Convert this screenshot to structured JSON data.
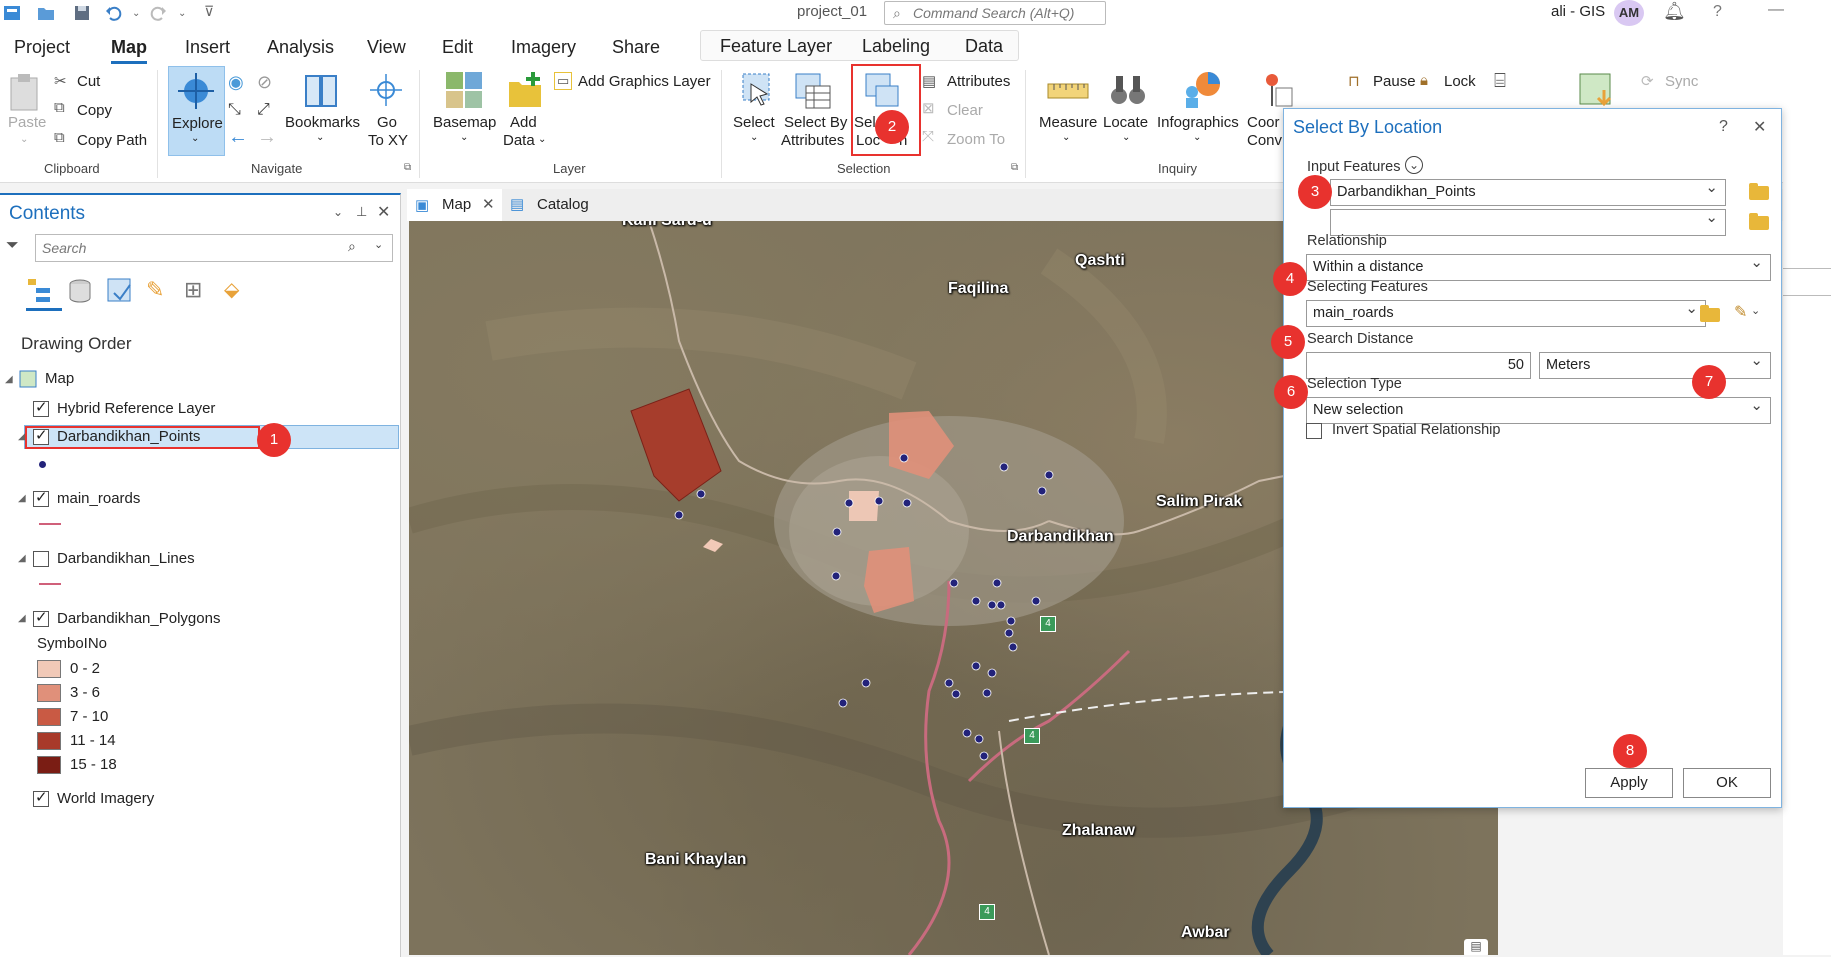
{
  "titlebar": {
    "project": "project_01",
    "command_search_placeholder": "Command Search (Alt+Q)",
    "user": "ali - GIS",
    "avatar_initials": "AM"
  },
  "menu_tabs": [
    "Project",
    "Map",
    "Insert",
    "Analysis",
    "View",
    "Edit",
    "Imagery",
    "Share"
  ],
  "contextual_tabs": [
    "Feature Layer",
    "Labeling",
    "Data"
  ],
  "ribbon": {
    "clipboard": {
      "paste": "Paste",
      "cut": "Cut",
      "copy": "Copy",
      "copy_path": "Copy Path",
      "group": "Clipboard"
    },
    "navigate": {
      "explore": "Explore",
      "bookmarks": "Bookmarks",
      "go": "Go",
      "to_xy": "To XY",
      "group": "Navigate"
    },
    "layer": {
      "basemap": "Basemap",
      "add": "Add",
      "data": "Data",
      "add_graphics": "Add Graphics Layer",
      "group": "Layer"
    },
    "selection": {
      "select": "Select",
      "select_by": "Select By",
      "attributes_label": "Attributes",
      "select_loc1": "Sel",
      "select_loc2": "Loc",
      "select_loc3": "n",
      "attributes": "Attributes",
      "clear": "Clear",
      "zoom_to": "Zoom To",
      "group": "Selection"
    },
    "inquiry": {
      "measure": "Measure",
      "locate": "Locate",
      "infographics": "Infographics",
      "coord1": "Coor",
      "coord2": "Conv",
      "group": "Inquiry"
    },
    "labeling": {
      "pause": "Pause",
      "lock": "Lock"
    },
    "sync": "Sync"
  },
  "contents": {
    "title": "Contents",
    "search_placeholder": "Search",
    "drawing_order": "Drawing Order",
    "map": "Map",
    "layers": {
      "hybrid": "Hybrid Reference Layer",
      "points": "Darbandikhan_Points",
      "roads": "main_roards",
      "lines": "Darbandikhan_Lines",
      "polygons": "Darbandikhan_Polygons",
      "symbol_field": "SymboINo",
      "classes": [
        {
          "label": "0 - 2",
          "color": "#f1c9b7"
        },
        {
          "label": "3 - 6",
          "color": "#e0907a"
        },
        {
          "label": "7 - 10",
          "color": "#c95a44"
        },
        {
          "label": "11 - 14",
          "color": "#a83a2a"
        },
        {
          "label": "15 - 18",
          "color": "#7a1d14"
        }
      ],
      "world_imagery": "World Imagery"
    }
  },
  "map_tabs": {
    "map": "Map",
    "catalog": "Catalog"
  },
  "map_labels": {
    "top": "Kani Sard-u",
    "qashti": "Qashti",
    "faqilina": "Faqilina",
    "salim": "Salim Pirak",
    "darbandikhan": "Darbandikhan",
    "zhalanaw": "Zhalanaw",
    "bani": "Bani Khaylan",
    "awbar": "Awbar",
    "shield": "4"
  },
  "dialog": {
    "title": "Select By Location",
    "help": "?",
    "close": "✕",
    "input_features_label": "Input Features",
    "input_features_value": "Darbandikhan_Points",
    "input_features_empty": "",
    "relationship_label": "Relationship",
    "relationship_value": "Within a distance",
    "selecting_features_label": "Selecting Features",
    "selecting_features_value": "main_roards",
    "search_distance_label": "Search Distance",
    "search_distance_value": "50",
    "search_distance_unit": "Meters",
    "selection_type_label": "Selection Type",
    "selection_type_value": "New selection",
    "invert_label": "Invert Spatial Relationship",
    "apply": "Apply",
    "ok": "OK"
  },
  "badges": [
    "1",
    "2",
    "3",
    "4",
    "5",
    "6",
    "7",
    "8"
  ],
  "colors": {
    "accent": "#1d6fbd",
    "badge": "#e8322e",
    "selected_row": "#cde4f7"
  }
}
